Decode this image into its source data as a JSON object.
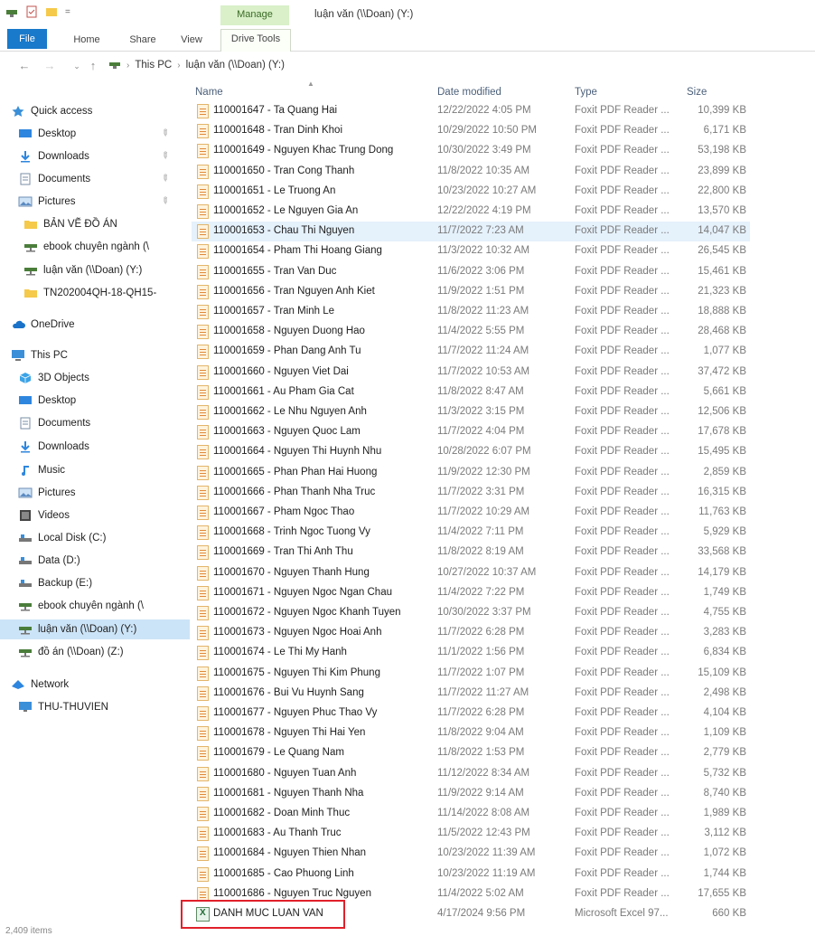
{
  "window": {
    "title": "luận văn (\\\\Doan) (Y:)",
    "manage_tab": "Manage",
    "drive_tools_tab": "Drive Tools"
  },
  "ribbon": {
    "tabs": [
      "File",
      "Home",
      "Share",
      "View"
    ]
  },
  "address": {
    "crumbs": [
      "This PC",
      "luận văn (\\\\Doan) (Y:)"
    ]
  },
  "columns": {
    "name": "Name",
    "date": "Date modified",
    "type": "Type",
    "size": "Size"
  },
  "sidebar": {
    "items": [
      {
        "label": "Quick access",
        "icon": "star-icon"
      },
      {
        "label": "Desktop",
        "icon": "desktop-icon",
        "pinned": true
      },
      {
        "label": "Downloads",
        "icon": "download-icon",
        "pinned": true
      },
      {
        "label": "Documents",
        "icon": "documents-icon",
        "pinned": true
      },
      {
        "label": "Pictures",
        "icon": "pictures-icon",
        "pinned": true
      },
      {
        "label": "BẢN VẼ ĐỒ ÁN",
        "icon": "folder-icon"
      },
      {
        "label": "ebook chuyên ngành (\\",
        "icon": "network-drive-icon"
      },
      {
        "label": "luận văn (\\\\Doan) (Y:)",
        "icon": "network-drive-icon"
      },
      {
        "label": "TN202004QH-18-QH15-",
        "icon": "folder-icon"
      },
      {
        "label": "OneDrive",
        "icon": "cloud-icon"
      },
      {
        "label": "This PC",
        "icon": "computer-icon"
      },
      {
        "label": "3D Objects",
        "icon": "cube-icon"
      },
      {
        "label": "Desktop",
        "icon": "desktop-icon"
      },
      {
        "label": "Documents",
        "icon": "documents-icon"
      },
      {
        "label": "Downloads",
        "icon": "download-icon"
      },
      {
        "label": "Music",
        "icon": "music-icon"
      },
      {
        "label": "Pictures",
        "icon": "pictures-icon"
      },
      {
        "label": "Videos",
        "icon": "video-icon"
      },
      {
        "label": "Local Disk (C:)",
        "icon": "disk-icon"
      },
      {
        "label": "Data (D:)",
        "icon": "disk-icon"
      },
      {
        "label": "Backup (E:)",
        "icon": "disk-icon"
      },
      {
        "label": "ebook chuyên ngành (\\",
        "icon": "network-drive-icon"
      },
      {
        "label": "luận văn (\\\\Doan) (Y:)",
        "icon": "network-drive-icon",
        "selected": true
      },
      {
        "label": "đồ án (\\\\Doan) (Z:)",
        "icon": "network-drive-icon"
      },
      {
        "label": "Network",
        "icon": "network-icon"
      },
      {
        "label": "THU-THUVIEN",
        "icon": "monitor-icon"
      }
    ]
  },
  "files": [
    {
      "name": "110001647 - Ta Quang Hai",
      "date": "12/22/2022 4:05 PM",
      "type": "Foxit PDF Reader ...",
      "size": "10,399 KB"
    },
    {
      "name": "110001648 - Tran Dinh Khoi",
      "date": "10/29/2022 10:50 PM",
      "type": "Foxit PDF Reader ...",
      "size": "6,171 KB"
    },
    {
      "name": "110001649 - Nguyen Khac Trung Dong",
      "date": "10/30/2022 3:49 PM",
      "type": "Foxit PDF Reader ...",
      "size": "53,198 KB"
    },
    {
      "name": "110001650 - Tran Cong Thanh",
      "date": "11/8/2022 10:35 AM",
      "type": "Foxit PDF Reader ...",
      "size": "23,899 KB"
    },
    {
      "name": "110001651 - Le Truong An",
      "date": "10/23/2022 10:27 AM",
      "type": "Foxit PDF Reader ...",
      "size": "22,800 KB"
    },
    {
      "name": "110001652 - Le Nguyen Gia An",
      "date": "12/22/2022 4:19 PM",
      "type": "Foxit PDF Reader ...",
      "size": "13,570 KB"
    },
    {
      "name": "110001653 - Chau Thi Nguyen",
      "date": "11/7/2022 7:23 AM",
      "type": "Foxit PDF Reader ...",
      "size": "14,047 KB",
      "highlight": true
    },
    {
      "name": "110001654 - Pham Thi Hoang Giang",
      "date": "11/3/2022 10:32 AM",
      "type": "Foxit PDF Reader ...",
      "size": "26,545 KB"
    },
    {
      "name": "110001655 - Tran Van Duc",
      "date": "11/6/2022 3:06 PM",
      "type": "Foxit PDF Reader ...",
      "size": "15,461 KB"
    },
    {
      "name": "110001656 - Tran Nguyen Anh Kiet",
      "date": "11/9/2022 1:51 PM",
      "type": "Foxit PDF Reader ...",
      "size": "21,323 KB"
    },
    {
      "name": "110001657 - Tran Minh Le",
      "date": "11/8/2022 11:23 AM",
      "type": "Foxit PDF Reader ...",
      "size": "18,888 KB"
    },
    {
      "name": "110001658 - Nguyen Duong Hao",
      "date": "11/4/2022 5:55 PM",
      "type": "Foxit PDF Reader ...",
      "size": "28,468 KB"
    },
    {
      "name": "110001659 - Phan Dang Anh Tu",
      "date": "11/7/2022 11:24 AM",
      "type": "Foxit PDF Reader ...",
      "size": "1,077 KB"
    },
    {
      "name": "110001660 - Nguyen Viet Dai",
      "date": "11/7/2022 10:53 AM",
      "type": "Foxit PDF Reader ...",
      "size": "37,472 KB"
    },
    {
      "name": "110001661 - Au Pham Gia Cat",
      "date": "11/8/2022 8:47 AM",
      "type": "Foxit PDF Reader ...",
      "size": "5,661 KB"
    },
    {
      "name": "110001662 - Le Nhu Nguyen Anh",
      "date": "11/3/2022 3:15 PM",
      "type": "Foxit PDF Reader ...",
      "size": "12,506 KB"
    },
    {
      "name": "110001663 - Nguyen Quoc Lam",
      "date": "11/7/2022 4:04 PM",
      "type": "Foxit PDF Reader ...",
      "size": "17,678 KB"
    },
    {
      "name": "110001664 - Nguyen Thi Huynh Nhu",
      "date": "10/28/2022 6:07 PM",
      "type": "Foxit PDF Reader ...",
      "size": "15,495 KB"
    },
    {
      "name": "110001665 - Phan Phan Hai Huong",
      "date": "11/9/2022 12:30 PM",
      "type": "Foxit PDF Reader ...",
      "size": "2,859 KB"
    },
    {
      "name": "110001666 - Phan Thanh Nha Truc",
      "date": "11/7/2022 3:31 PM",
      "type": "Foxit PDF Reader ...",
      "size": "16,315 KB"
    },
    {
      "name": "110001667 - Pham Ngoc Thao",
      "date": "11/7/2022 10:29 AM",
      "type": "Foxit PDF Reader ...",
      "size": "11,763 KB"
    },
    {
      "name": "110001668 - Trinh Ngoc Tuong Vy",
      "date": "11/4/2022 7:11 PM",
      "type": "Foxit PDF Reader ...",
      "size": "5,929 KB"
    },
    {
      "name": "110001669 - Tran Thi Anh Thu",
      "date": "11/8/2022 8:19 AM",
      "type": "Foxit PDF Reader ...",
      "size": "33,568 KB"
    },
    {
      "name": "110001670 - Nguyen Thanh Hung",
      "date": "10/27/2022 10:37 AM",
      "type": "Foxit PDF Reader ...",
      "size": "14,179 KB"
    },
    {
      "name": "110001671 - Nguyen Ngoc Ngan Chau",
      "date": "11/4/2022 7:22 PM",
      "type": "Foxit PDF Reader ...",
      "size": "1,749 KB"
    },
    {
      "name": "110001672 - Nguyen Ngoc Khanh Tuyen",
      "date": "10/30/2022 3:37 PM",
      "type": "Foxit PDF Reader ...",
      "size": "4,755 KB"
    },
    {
      "name": "110001673 - Nguyen Ngoc Hoai Anh",
      "date": "11/7/2022 6:28 PM",
      "type": "Foxit PDF Reader ...",
      "size": "3,283 KB"
    },
    {
      "name": "110001674 - Le Thi My Hanh",
      "date": "11/1/2022 1:56 PM",
      "type": "Foxit PDF Reader ...",
      "size": "6,834 KB"
    },
    {
      "name": "110001675 - Nguyen Thi Kim Phung",
      "date": "11/7/2022 1:07 PM",
      "type": "Foxit PDF Reader ...",
      "size": "15,109 KB"
    },
    {
      "name": "110001676 - Bui Vu Huynh Sang",
      "date": "11/7/2022 11:27 AM",
      "type": "Foxit PDF Reader ...",
      "size": "2,498 KB"
    },
    {
      "name": "110001677 - Nguyen Phuc Thao Vy",
      "date": "11/7/2022 6:28 PM",
      "type": "Foxit PDF Reader ...",
      "size": "4,104 KB"
    },
    {
      "name": "110001678 - Nguyen Thi Hai Yen",
      "date": "11/8/2022 9:04 AM",
      "type": "Foxit PDF Reader ...",
      "size": "1,109 KB"
    },
    {
      "name": "110001679 - Le Quang Nam",
      "date": "11/8/2022 1:53 PM",
      "type": "Foxit PDF Reader ...",
      "size": "2,779 KB"
    },
    {
      "name": "110001680 - Nguyen Tuan Anh",
      "date": "11/12/2022 8:34 AM",
      "type": "Foxit PDF Reader ...",
      "size": "5,732 KB"
    },
    {
      "name": "110001681 - Nguyen Thanh Nha",
      "date": "11/9/2022 9:14 AM",
      "type": "Foxit PDF Reader ...",
      "size": "8,740 KB"
    },
    {
      "name": "110001682 - Doan Minh Thuc",
      "date": "11/14/2022 8:08 AM",
      "type": "Foxit PDF Reader ...",
      "size": "1,989 KB"
    },
    {
      "name": "110001683 - Au Thanh Truc",
      "date": "11/5/2022 12:43 PM",
      "type": "Foxit PDF Reader ...",
      "size": "3,112 KB"
    },
    {
      "name": "110001684 - Nguyen Thien Nhan",
      "date": "10/23/2022 11:39 AM",
      "type": "Foxit PDF Reader ...",
      "size": "1,072 KB"
    },
    {
      "name": "110001685 - Cao Phuong Linh",
      "date": "10/23/2022 11:19 AM",
      "type": "Foxit PDF Reader ...",
      "size": "1,744 KB"
    },
    {
      "name": "110001686 - Nguyen Truc Nguyen",
      "date": "11/4/2022 5:02 AM",
      "type": "Foxit PDF Reader ...",
      "size": "17,655 KB"
    },
    {
      "name": "DANH MUC LUAN VAN",
      "date": "4/17/2024 9:56 PM",
      "type": "Microsoft Excel 97...",
      "size": "660 KB",
      "excel": true
    }
  ],
  "status": {
    "item_count": "2,409 items"
  },
  "colors": {
    "file_tab": "#1979ca",
    "manage_tab": "#d9f0c8",
    "selection": "#cce4f7",
    "highlight_row": "#e5f1fb",
    "callout_box": "#e0202a"
  }
}
